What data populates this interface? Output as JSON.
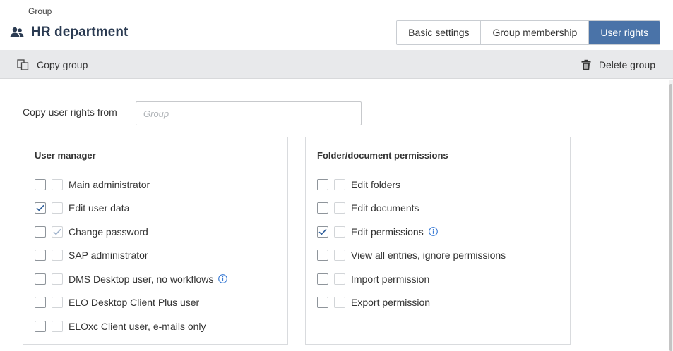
{
  "header": {
    "breadcrumb": "Group",
    "title": "HR department",
    "title_icon": "people-icon"
  },
  "tabs": [
    {
      "label": "Basic settings",
      "active": false
    },
    {
      "label": "Group membership",
      "active": false
    },
    {
      "label": "User rights",
      "active": true
    }
  ],
  "toolbar": {
    "copy_label": "Copy group",
    "copy_icon": "copy-icon",
    "delete_label": "Delete group",
    "delete_icon": "trash-icon"
  },
  "copy_rights": {
    "label": "Copy user rights from",
    "placeholder": "Group",
    "value": ""
  },
  "user_manager": {
    "title": "User manager",
    "items": [
      {
        "label": "Main administrator",
        "checked": false,
        "inherited": false,
        "info": false
      },
      {
        "label": "Edit user data",
        "checked": true,
        "inherited": false,
        "info": false
      },
      {
        "label": "Change password",
        "checked": false,
        "inherited": true,
        "info": false
      },
      {
        "label": "SAP administrator",
        "checked": false,
        "inherited": false,
        "info": false
      },
      {
        "label": "DMS Desktop user, no workflows",
        "checked": false,
        "inherited": false,
        "info": true
      },
      {
        "label": "ELO Desktop Client Plus user",
        "checked": false,
        "inherited": false,
        "info": false
      },
      {
        "label": "ELOxc Client user, e-mails only",
        "checked": false,
        "inherited": false,
        "info": false
      }
    ]
  },
  "folder_permissions": {
    "title": "Folder/document permissions",
    "items": [
      {
        "label": "Edit folders",
        "checked": false,
        "inherited": false,
        "info": false
      },
      {
        "label": "Edit documents",
        "checked": false,
        "inherited": false,
        "info": false
      },
      {
        "label": "Edit permissions",
        "checked": true,
        "inherited": false,
        "info": true
      },
      {
        "label": "View all entries, ignore permissions",
        "checked": false,
        "inherited": false,
        "info": false
      },
      {
        "label": "Import permission",
        "checked": false,
        "inherited": false,
        "info": false
      },
      {
        "label": "Export permission",
        "checked": false,
        "inherited": false,
        "info": false
      }
    ]
  },
  "colors": {
    "accent": "#4a73a8",
    "title": "#2b3b52",
    "check": "#2f5f9b",
    "inherited_check": "#9fb3cc",
    "info": "#3a7bd5",
    "toolbar_bg": "#e8e9eb"
  }
}
